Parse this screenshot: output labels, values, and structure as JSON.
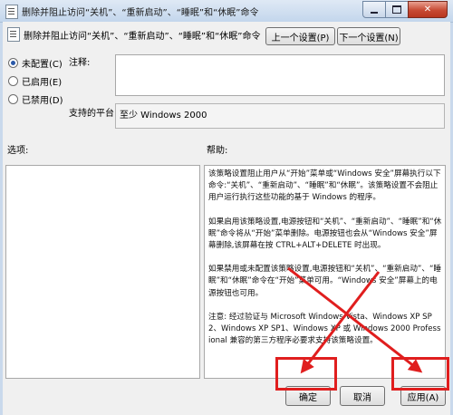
{
  "window": {
    "title": "删除并阻止访问“关机”、“重新启动”、“睡眠”和“休眠”命令"
  },
  "policy": {
    "title": "删除并阻止访问“关机”、“重新启动”、“睡眠”和“休眠”命令"
  },
  "nav": {
    "prev_label": "上一个设置(P)",
    "next_label": "下一个设置(N)"
  },
  "state_options": [
    {
      "label": "未配置(C)",
      "checked": true
    },
    {
      "label": "已启用(E)",
      "checked": false
    },
    {
      "label": "已禁用(D)",
      "checked": false
    }
  ],
  "comment": {
    "label": "注释:",
    "value": ""
  },
  "platform": {
    "label": "支持的平台:",
    "value": "至少 Windows 2000"
  },
  "options": {
    "label": "选项:"
  },
  "help": {
    "label": "帮助:",
    "paragraphs": [
      "该策略设置阻止用户从“开始”菜单或“Windows 安全”屏幕执行以下命令:“关机”、“重新启动”、“睡眠”和“休眠”。该策略设置不会阻止用户运行执行这些功能的基于 Windows 的程序。",
      "如果启用该策略设置,电源按钮和“关机”、“重新启动”、“睡眠”和“休眠”命令将从“开始”菜单删除。电源按钮也会从“Windows 安全”屏幕删除,该屏幕在按 CTRL+ALT+DELETE 时出现。",
      "如果禁用或未配置该策略设置,电源按钮和“关机”、“重新启动”、“睡眠”和“休眠”命令在“开始”菜单可用。“Windows 安全”屏幕上的电源按钮也可用。",
      "注意: 经过验证与 Microsoft Windows Vista、Windows XP SP2、Windows XP SP1、Windows XP 或 Windows 2000 Professional 兼容的第三方程序必要求支持该策略设置。"
    ]
  },
  "footer": {
    "ok_label": "确定",
    "cancel_label": "取消",
    "apply_label": "应用(A)"
  },
  "colors": {
    "annotation": "#e01e1e"
  }
}
